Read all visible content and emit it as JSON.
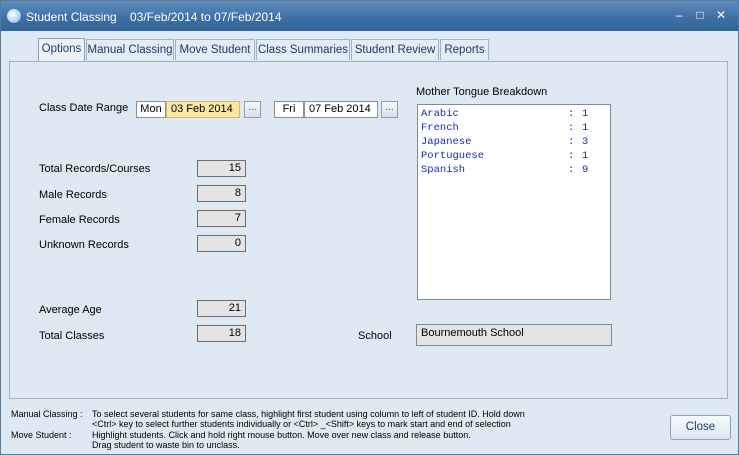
{
  "window": {
    "title": "Student Classing    03/Feb/2014 to 07/Feb/2014",
    "minimize": "–",
    "maximize": "□",
    "close": "✕"
  },
  "tabs": [
    {
      "label": "Options"
    },
    {
      "label": "Manual Classing"
    },
    {
      "label": "Move Student"
    },
    {
      "label": "Class Summaries"
    },
    {
      "label": "Student Review"
    },
    {
      "label": "Reports"
    }
  ],
  "options": {
    "date_range_label": "Class Date Range",
    "from_day": "Mon",
    "from_date": "03 Feb 2014",
    "to_day": "Fri",
    "to_date": "07 Feb 2014",
    "ellipsis": "...",
    "stats": [
      {
        "label": "Total Records/Courses",
        "value": "15"
      },
      {
        "label": "Male Records",
        "value": "8"
      },
      {
        "label": "Female Records",
        "value": "7"
      },
      {
        "label": "Unknown Records",
        "value": "0"
      }
    ],
    "average_age_label": "Average Age",
    "average_age": "21",
    "total_classes_label": "Total Classes",
    "total_classes": "18",
    "mother_tongue_title": "Mother Tongue Breakdown",
    "mother_tongue": [
      {
        "language": "Arabic",
        "count": "1"
      },
      {
        "language": "French",
        "count": "1"
      },
      {
        "language": "Japanese",
        "count": "3"
      },
      {
        "language": "Portuguese",
        "count": "1"
      },
      {
        "language": "Spanish",
        "count": "9"
      }
    ],
    "school_label": "School",
    "school": "Bournemouth School"
  },
  "footer": {
    "manual_label": "Manual Classing :",
    "manual_line1": "To select several students for same class, highlight first student using column to left of student ID. Hold down",
    "manual_line2": "<Ctrl>  key to select further students individually or <Ctrl> _<Shift>  keys to mark start and end of selection",
    "move_label": "Move Student :",
    "move_line1": "Highlight students. Click and hold right mouse button. Move over new class and release button.",
    "move_line2": "Drag student to waste bin to unclass."
  },
  "close_button": "Close"
}
